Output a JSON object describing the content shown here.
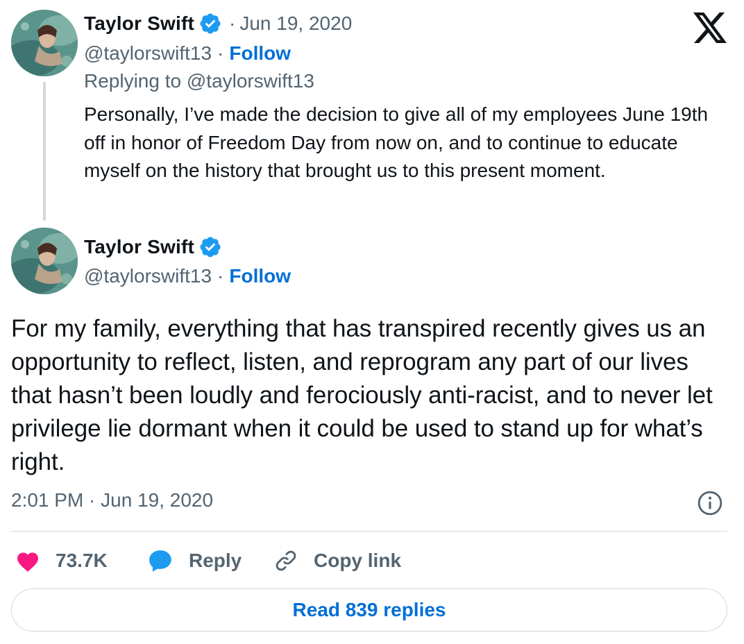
{
  "colors": {
    "text_primary": "#0f1419",
    "text_secondary": "#536471",
    "link_blue": "#006fd6",
    "verified_blue": "#1d9bf0",
    "like_pink": "#f91880",
    "border": "#cfd9de"
  },
  "brand": {
    "logo_icon": "x-logo-icon"
  },
  "reply_tweet": {
    "author_name": "Taylor Swift",
    "date_sep": "·",
    "date": "Jun 19, 2020",
    "handle": "@taylorswift13",
    "handle_sep": "·",
    "follow_label": "Follow",
    "replying_to": "Replying to @taylorswift13",
    "body": "Personally, I’ve made the decision to give all of my employees June 19th off in honor of Freedom Day from now on, and to continue to educate myself on the history that brought us to this present moment."
  },
  "main_tweet": {
    "author_name": "Taylor Swift",
    "handle": "@taylorswift13",
    "handle_sep": "·",
    "follow_label": "Follow",
    "body": "For my family, everything that has transpired recently gives us an opportunity to reflect, listen, and reprogram any part of our lives that hasn’t been loudly and ferociously anti-racist, and to never let privilege lie dormant when it could be used to stand up for what’s right.",
    "timestamp": "2:01 PM · Jun 19, 2020"
  },
  "actions": {
    "like_count": "73.7K",
    "reply_label": "Reply",
    "copy_link_label": "Copy link"
  },
  "footer": {
    "read_replies_label": "Read 839 replies"
  }
}
